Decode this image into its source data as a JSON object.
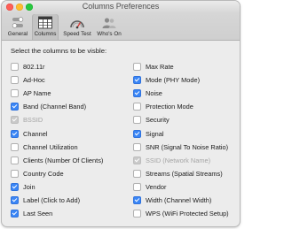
{
  "window": {
    "title": "Columns Preferences"
  },
  "toolbar": {
    "items": [
      {
        "label": "General",
        "icon": "switches-icon",
        "active": false
      },
      {
        "label": "Columns",
        "icon": "columns-grid-icon",
        "active": true
      },
      {
        "label": "Speed Test",
        "icon": "speedometer-icon",
        "active": false
      },
      {
        "label": "Who's On",
        "icon": "users-icon",
        "active": false
      }
    ]
  },
  "heading": "Select the columns to be visble:",
  "columns_left": [
    {
      "label": "802.11r",
      "checked": false,
      "enabled": true
    },
    {
      "label": "Ad-Hoc",
      "checked": false,
      "enabled": true
    },
    {
      "label": "AP Name",
      "checked": false,
      "enabled": true
    },
    {
      "label": "Band (Channel Band)",
      "checked": true,
      "enabled": true
    },
    {
      "label": "BSSID",
      "checked": true,
      "enabled": false
    },
    {
      "label": "Channel",
      "checked": true,
      "enabled": true
    },
    {
      "label": "Channel Utilization",
      "checked": false,
      "enabled": true
    },
    {
      "label": "Clients (Number Of Clients)",
      "checked": false,
      "enabled": true
    },
    {
      "label": "Country Code",
      "checked": false,
      "enabled": true
    },
    {
      "label": "Join",
      "checked": true,
      "enabled": true
    },
    {
      "label": "Label (Click to Add)",
      "checked": true,
      "enabled": true
    },
    {
      "label": "Last Seen",
      "checked": true,
      "enabled": true
    }
  ],
  "columns_right": [
    {
      "label": "Max Rate",
      "checked": false,
      "enabled": true
    },
    {
      "label": "Mode (PHY Mode)",
      "checked": true,
      "enabled": true
    },
    {
      "label": "Noise",
      "checked": true,
      "enabled": true
    },
    {
      "label": "Protection Mode",
      "checked": false,
      "enabled": true
    },
    {
      "label": "Security",
      "checked": false,
      "enabled": true
    },
    {
      "label": "Signal",
      "checked": true,
      "enabled": true
    },
    {
      "label": "SNR (Signal To Noise Ratio)",
      "checked": false,
      "enabled": true
    },
    {
      "label": "SSID (Network Name)",
      "checked": true,
      "enabled": false
    },
    {
      "label": "Streams (Spatial Streams)",
      "checked": false,
      "enabled": true
    },
    {
      "label": "Vendor",
      "checked": false,
      "enabled": true
    },
    {
      "label": "Width (Channel Width)",
      "checked": true,
      "enabled": true
    },
    {
      "label": "WPS (WiFi Protected Setup)",
      "checked": false,
      "enabled": true
    }
  ]
}
